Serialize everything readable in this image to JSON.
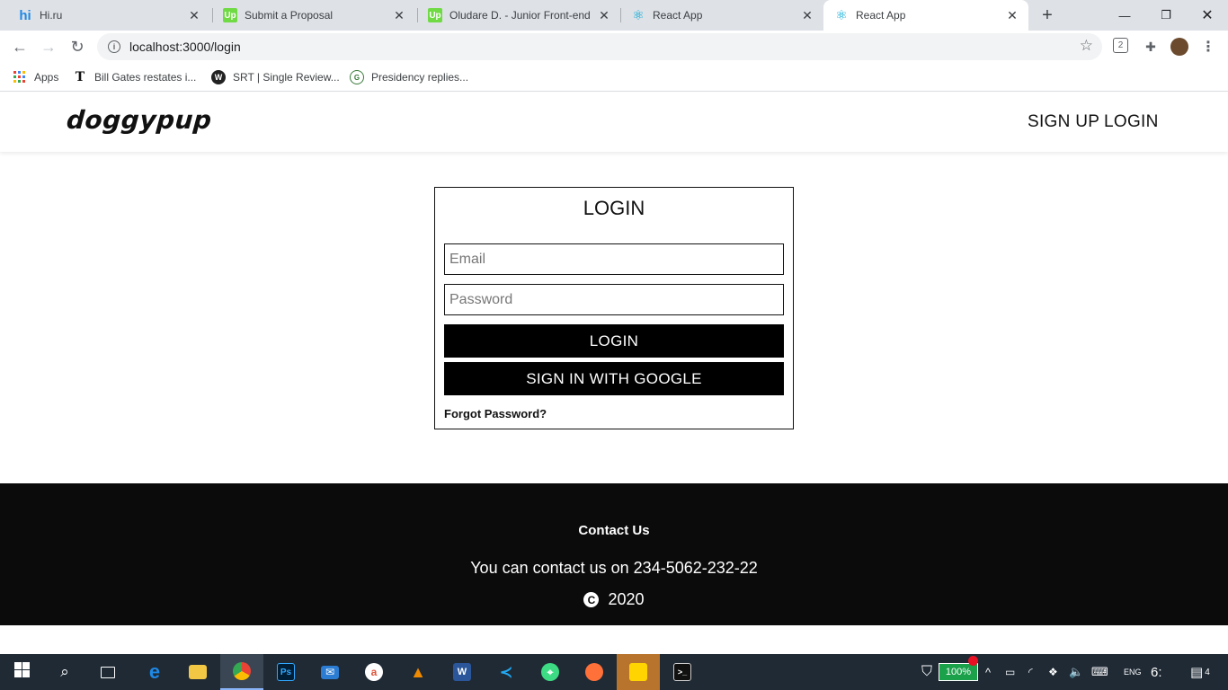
{
  "browser": {
    "tabs": [
      {
        "title": "Hi.ru",
        "favicon": "hi-logo-icon",
        "active": false
      },
      {
        "title": "Submit a Proposal",
        "favicon": "upwork-icon",
        "active": false
      },
      {
        "title": "Oludare D. - Junior Front-end",
        "favicon": "upwork-icon",
        "active": false
      },
      {
        "title": "React App",
        "favicon": "react-icon",
        "active": false
      },
      {
        "title": "React App",
        "favicon": "react-icon",
        "active": true
      }
    ],
    "url": "localhost:3000/login",
    "bookmarks": [
      {
        "label": "Apps",
        "icon": "apps-grid-icon"
      },
      {
        "label": "Bill Gates restates i...",
        "icon": "news-icon"
      },
      {
        "label": "SRT | Single Review...",
        "icon": "srt-icon"
      },
      {
        "label": "Presidency replies...",
        "icon": "news-icon"
      }
    ]
  },
  "header": {
    "logo": "doggypup",
    "nav": [
      "SIGN UP",
      "LOGIN"
    ]
  },
  "login": {
    "title": "LOGIN",
    "email_placeholder": "Email",
    "password_placeholder": "Password",
    "login_button": "LOGIN",
    "google_button": "SIGN IN WITH GOOGLE",
    "forgot_link": "Forgot Password?"
  },
  "footer": {
    "contact_title": "Contact Us",
    "contact_text": "You can contact us on 234-5062-232-22",
    "copyright_year": "2020"
  },
  "taskbar": {
    "battery": "100%",
    "time": "6:",
    "notifications": "4"
  },
  "colors": {
    "footer_bg": "#0b0b0b",
    "button_bg": "#000000",
    "taskbar_bg": "#1f2a35",
    "tabbar_bg": "#dee1e6"
  }
}
